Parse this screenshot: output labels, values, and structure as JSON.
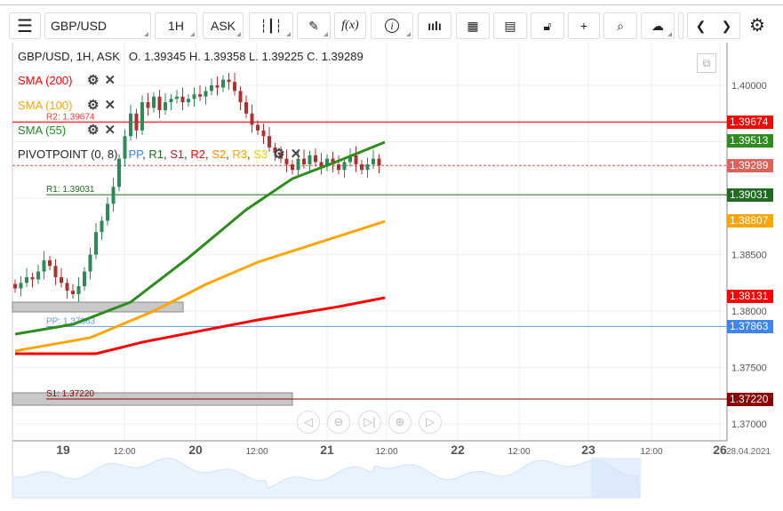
{
  "toolbar": {
    "symbol": "GBP/USD",
    "interval": "1H",
    "price_type": "ASK",
    "icons": [
      "menu-icon",
      "candles-icon",
      "pencil-icon",
      "fx-icon",
      "info-icon",
      "bars-icon",
      "calendar-icon",
      "report-icon",
      "lock-icon",
      "crosshair-icon",
      "zoom-icon",
      "cloud-upload-icon",
      "chevron-left-icon",
      "chevron-right-icon",
      "gear-icon"
    ],
    "fx_label": "f(x)",
    "info_label": "i"
  },
  "header": {
    "title": "GBP/USD, 1H, ASK",
    "ohlc": "O. 1.39345 H. 1.39358 L. 1.39225 C. 1.39289"
  },
  "indicators": [
    {
      "label": "SMA (200)",
      "color": "#ff0000"
    },
    {
      "label": "SMA (100)",
      "color": "#ffa500"
    },
    {
      "label": "SMA (55)",
      "color": "#228b22"
    }
  ],
  "pivot": {
    "label": "PIVOTPOINT (0, 8)",
    "parts": [
      {
        "t": "PP",
        "c": "#3d85f0"
      },
      {
        "t": "R1",
        "c": "#1f6b1f"
      },
      {
        "t": "S1",
        "c": "#b22222"
      },
      {
        "t": "R2",
        "c": "#ff0000"
      },
      {
        "t": "S2",
        "c": "#ff8c00"
      },
      {
        "t": "R3",
        "c": "#ffa500"
      },
      {
        "t": "S3",
        "c": "#e6d000"
      }
    ]
  },
  "chart_data": {
    "type": "candlestick",
    "ylim": [
      1.368,
      1.4037
    ],
    "y_ticks": [
      "1.40000",
      "1.38500",
      "1.38000",
      "1.37500",
      "1.37000"
    ],
    "x_ticks": [
      {
        "l": "19",
        "bold": true
      },
      {
        "l": "12:00"
      },
      {
        "l": "20",
        "bold": true
      },
      {
        "l": "12:00"
      },
      {
        "l": "21",
        "bold": true
      },
      {
        "l": "12:00"
      },
      {
        "l": "22",
        "bold": true
      },
      {
        "l": "12:00"
      },
      {
        "l": "23",
        "bold": true
      },
      {
        "l": "12:00"
      },
      {
        "l": "26",
        "bold": true
      }
    ],
    "date_label": "28.04.2021",
    "closes": [
      1.382,
      1.3825,
      1.383,
      1.3828,
      1.3835,
      1.3845,
      1.384,
      1.383,
      1.3825,
      1.3818,
      1.3815,
      1.3822,
      1.3835,
      1.385,
      1.387,
      1.388,
      1.3895,
      1.391,
      1.3935,
      1.3955,
      1.3975,
      1.396,
      1.3985,
      1.398,
      1.399,
      1.3978,
      1.3985,
      1.3988,
      1.399,
      1.3985,
      1.3988,
      1.3992,
      1.399,
      1.3995,
      1.4,
      1.3998,
      1.4005,
      1.4003,
      1.3995,
      1.3985,
      1.3975,
      1.3965,
      1.396,
      1.3955,
      1.3945,
      1.394,
      1.3935,
      1.393,
      1.3925,
      1.3935,
      1.393,
      1.3938,
      1.3932,
      1.3928,
      1.3935,
      1.393,
      1.3925,
      1.3932,
      1.3938,
      1.393,
      1.3925,
      1.393,
      1.3935,
      1.3929
    ],
    "sma": [
      {
        "name": "SMA (55)",
        "color": "#2e8b1e",
        "points": [
          [
            0,
            1.37795
          ],
          [
            10,
            1.37882
          ],
          [
            20,
            1.38079
          ],
          [
            30,
            1.38472
          ],
          [
            40,
            1.38898
          ],
          [
            48,
            1.39173
          ],
          [
            56,
            1.39331
          ],
          [
            64,
            1.39496
          ]
        ]
      },
      {
        "name": "SMA (100)",
        "color": "#ffa500",
        "points": [
          [
            0,
            1.37646
          ],
          [
            13,
            1.37764
          ],
          [
            24,
            1.38
          ],
          [
            33,
            1.38236
          ],
          [
            42,
            1.38433
          ],
          [
            54,
            1.3863
          ],
          [
            64,
            1.38795
          ]
        ]
      },
      {
        "name": "SMA (200)",
        "color": "#ff0000",
        "points": [
          [
            0,
            1.37622
          ],
          [
            14,
            1.37622
          ],
          [
            22,
            1.37724
          ],
          [
            34,
            1.37843
          ],
          [
            42,
            1.37921
          ],
          [
            56,
            1.38039
          ],
          [
            64,
            1.38118
          ]
        ]
      }
    ],
    "levels": [
      {
        "label": "R2: 1.39674",
        "value": 1.39674,
        "tag": "1.39674",
        "color": "#ff3333",
        "tagbg": "#ff0000"
      },
      {
        "label": "R1: 1.39031",
        "value": 1.39031,
        "tag": "1.39031",
        "color": "#1f6b1f",
        "tagbg": "#1f6b1f"
      },
      {
        "label": "PP: 1.37863",
        "value": 1.37863,
        "tag": "1.37863",
        "color": "#5a9bf0",
        "tagbg": "#3d85f0"
      },
      {
        "label": "S1: 1.37220",
        "value": 1.3722,
        "tag": "1.37220",
        "color": "#8b0000",
        "tagbg": "#8b0000"
      }
    ],
    "price_tags": [
      {
        "value": 1.39513,
        "tag": "1.39513",
        "bg": "#2e8b1e"
      },
      {
        "value": 1.38807,
        "tag": "1.38807",
        "bg": "#ffa500"
      },
      {
        "value": 1.38131,
        "tag": "1.38131",
        "bg": "#ff0000"
      }
    ],
    "current": {
      "value": 1.39289,
      "tag": "1.39289",
      "bg": "#e0605a"
    }
  }
}
